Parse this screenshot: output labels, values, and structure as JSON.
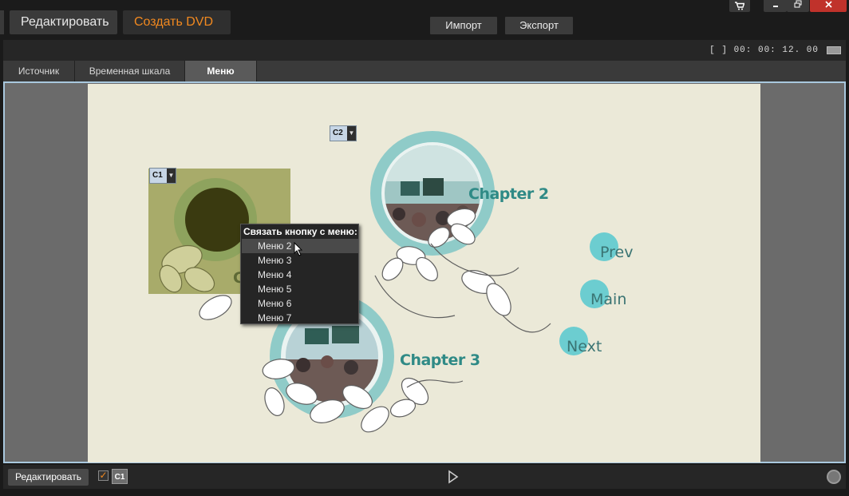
{
  "titlebar": {
    "edit_mode": "Редактировать",
    "dvd_mode": "Создать DVD",
    "import": "Импорт",
    "export": "Экспорт",
    "accent_color": "#f2891f"
  },
  "timecode": "[ ] 00: 00: 12. 00",
  "tabs": [
    {
      "label": "Источник"
    },
    {
      "label": "Временная шкала"
    },
    {
      "label": "Меню"
    }
  ],
  "canvas": {
    "chapter2": "Chapter 2",
    "chapter3": "Chapter 3",
    "chapter1_partial": "C",
    "prev": "Prev",
    "main": "Main",
    "next": "Next",
    "markers": {
      "c1": "C1",
      "c2": "C2"
    }
  },
  "link_menu": {
    "title": "Связать кнопку с меню:",
    "items": [
      "Меню 2",
      "Меню 3",
      "Меню 4",
      "Меню 5",
      "Меню 6",
      "Меню 7"
    ],
    "selected": "Меню 2"
  },
  "bottombar": {
    "edit_button": "Редактировать",
    "chapter_badge": "C1"
  }
}
